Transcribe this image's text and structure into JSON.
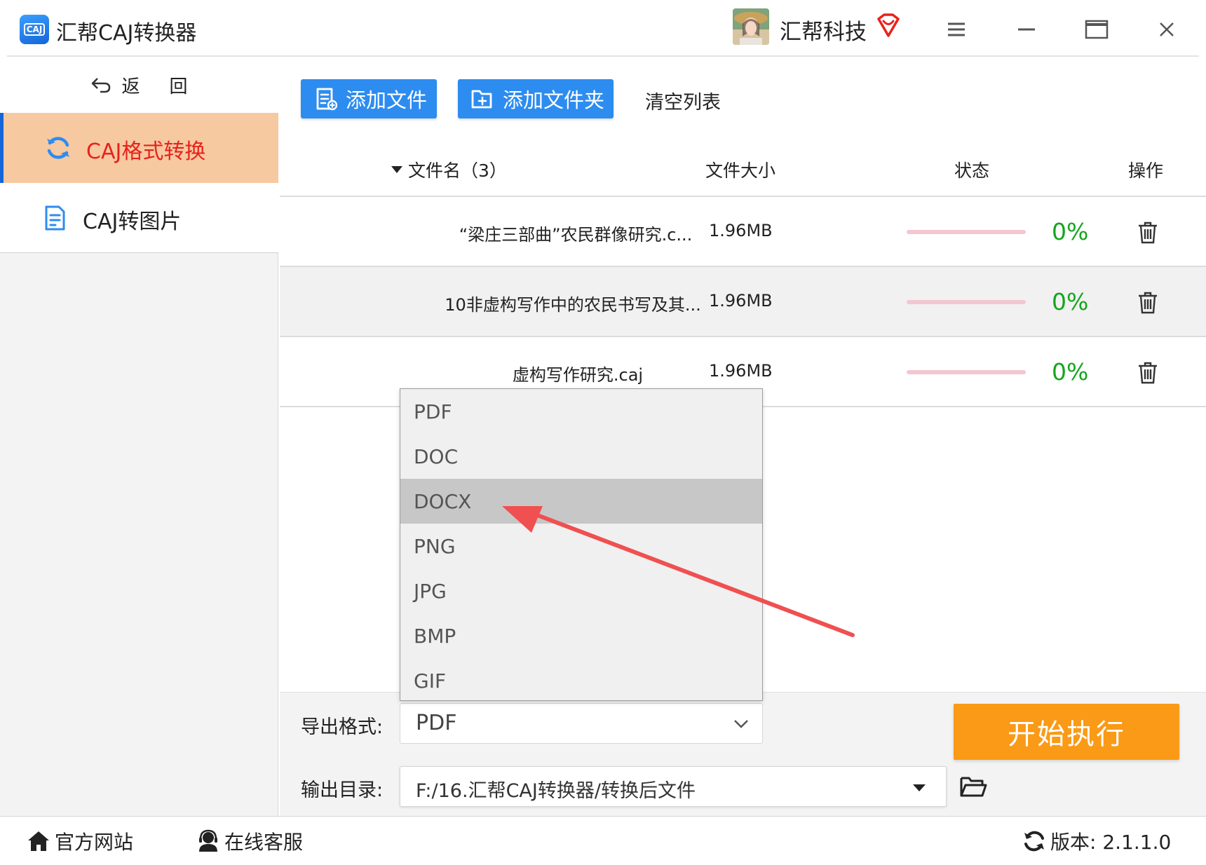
{
  "app": {
    "title": "汇帮CAJ转换器",
    "logo_text": "CAJ",
    "brand": "汇帮科技",
    "icons": [
      "avatar",
      "vip-heart-icon",
      "menu-icon",
      "minimize-icon",
      "maximize-icon",
      "close-icon"
    ]
  },
  "sidebar": {
    "back_label_1": "返",
    "back_label_2": "回",
    "items": [
      {
        "label": "CAJ格式转换",
        "icon": "refresh-icon",
        "active": true
      },
      {
        "label": "CAJ转图片",
        "icon": "document-icon",
        "active": false
      }
    ]
  },
  "toolbar": {
    "add_file": "添加文件",
    "add_folder": "添加文件夹",
    "clear_list": "清空列表"
  },
  "table": {
    "headers": {
      "filename": "文件名（3）",
      "filesize": "文件大小",
      "status": "状态",
      "action": "操作"
    },
    "rows": [
      {
        "name": "“梁庄三部曲”农民群像研究.c...",
        "size": "1.96MB",
        "progress_label": "0%",
        "progress": 0
      },
      {
        "name": "10非虚构写作中的农民书写及其...",
        "size": "1.96MB",
        "progress_label": "0%",
        "progress": 0
      },
      {
        "name": "虚构写作研究.caj",
        "size": "1.96MB",
        "progress_label": "0%",
        "progress": 0
      }
    ]
  },
  "format_dropdown": {
    "options": [
      "PDF",
      "DOC",
      "DOCX",
      "PNG",
      "JPG",
      "BMP",
      "GIF"
    ],
    "highlighted": "DOCX"
  },
  "export": {
    "format_label": "导出格式:",
    "format_value": "PDF",
    "dir_label": "输出目录:",
    "dir_value": "F:/16.汇帮CAJ转换器/转换后文件",
    "start_button": "开始执行"
  },
  "statusbar": {
    "website": "官方网站",
    "support": "在线客服",
    "version": "版本: 2.1.1.0"
  },
  "colors": {
    "primary_blue": "#2d8cf0",
    "active_nav_bg": "#f6c9a1",
    "active_nav_text": "#e8221b",
    "progress_track": "#f3c6d2",
    "percent_green": "#15a51d",
    "start_orange": "#fa9a16",
    "annotation_arrow": "#f05050"
  }
}
